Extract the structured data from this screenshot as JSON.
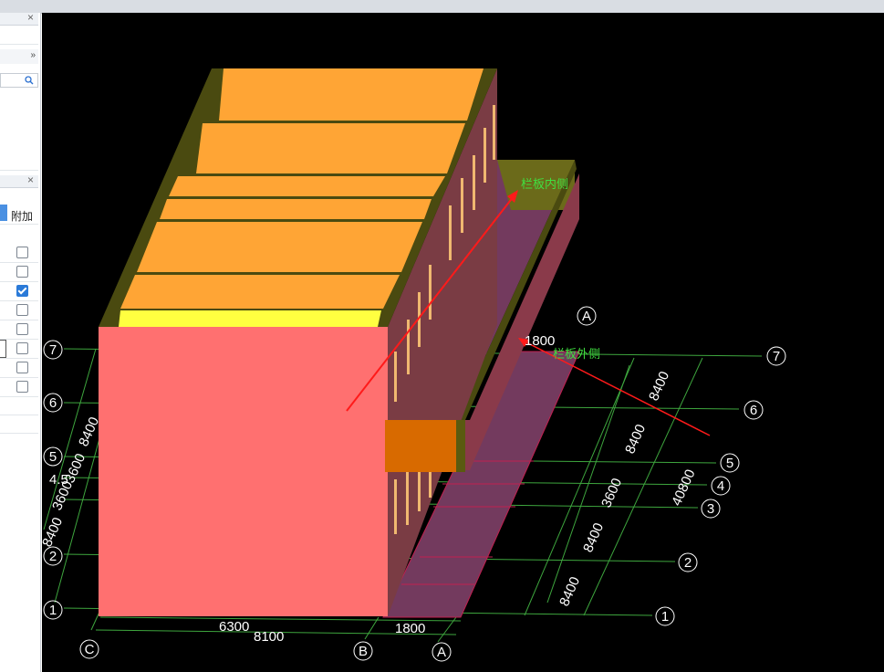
{
  "window": {
    "close_glyph": "×"
  },
  "left_panel": {
    "expand_glyph": "»",
    "column_header": "附加",
    "checkboxes": [
      {
        "checked": false
      },
      {
        "checked": false
      },
      {
        "checked": true
      },
      {
        "checked": false
      },
      {
        "checked": false
      },
      {
        "checked": false
      },
      {
        "checked": false
      },
      {
        "checked": false
      }
    ]
  },
  "scene": {
    "annotations": {
      "inner": "栏板内侧",
      "outer": "栏板外侧"
    },
    "axis_numbers": {
      "a1": "7",
      "a2": "6",
      "a3": "5",
      "a4": "4",
      "a5": "3",
      "a6": "2",
      "a7": "1"
    },
    "left_axis_labels": {
      "l7": "7",
      "l6": "6",
      "l5": "5",
      "l4": "4",
      "l2": "2",
      "l1": "1"
    },
    "axis_letters": {
      "c": "C",
      "b": "B",
      "a_bottom": "A",
      "a_top": "A"
    },
    "dims_bottom": {
      "d1": "6300",
      "d2": "8100",
      "d3": "1800"
    },
    "dims_right": {
      "r1": "8400",
      "r2": "8400",
      "r3": "3600",
      "r4": "40800",
      "r5": "8400",
      "r6": "8400",
      "top": "1800"
    },
    "dims_left": {
      "l1": "8400",
      "l2": "3600",
      "l3": "3600",
      "l4": "4.5",
      "l5": "8400"
    },
    "colors": {
      "roof_slab": "#ffa535",
      "wall_front": "#ff7070",
      "balcony": "#733a5e",
      "rail_inner": "#6b6a1a",
      "grid": "#3ea63e",
      "arrow": "#ff1a1a"
    }
  }
}
